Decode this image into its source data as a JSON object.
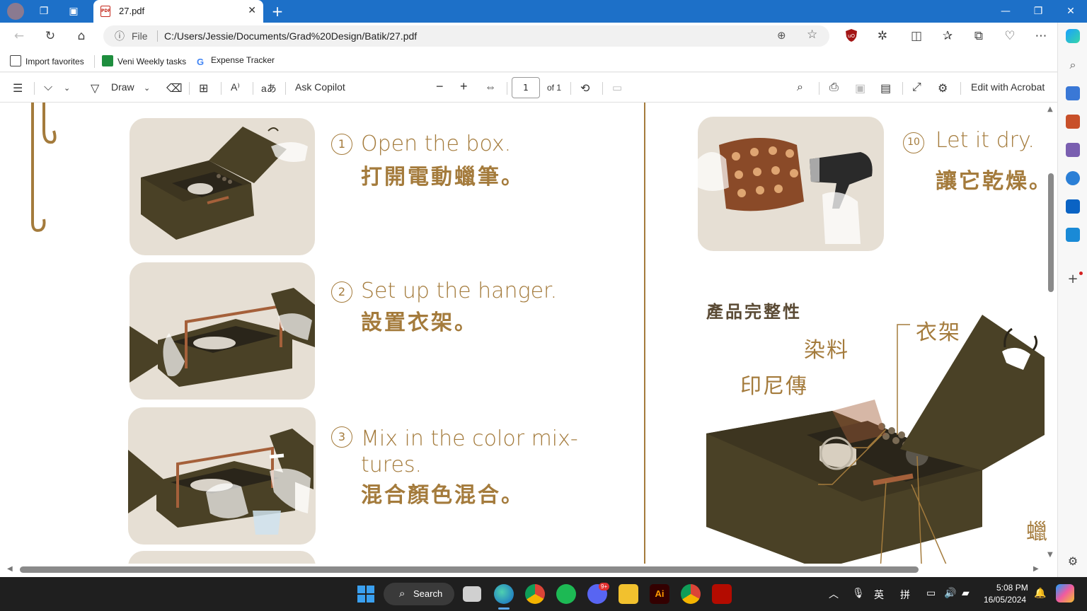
{
  "browser": {
    "tab_title": "27.pdf",
    "new_tab_symbol": "+",
    "url_prefix": "File",
    "url": "C:/Users/Jessie/Documents/Grad%20Design/Batik/27.pdf",
    "favorites": [
      {
        "label": "Import favorites",
        "icon": "import-icon"
      },
      {
        "label": "Veni Weekly tasks",
        "icon": "sheets-icon"
      },
      {
        "label": "Expense Tracker",
        "icon": "google-icon"
      }
    ]
  },
  "pdf_toolbar": {
    "draw_label": "Draw",
    "ask_copilot_label": "Ask Copilot",
    "page_number": "1",
    "page_total": "of 1",
    "edit_label": "Edit with Acrobat"
  },
  "document": {
    "steps": [
      {
        "num": "1",
        "en": "Open the box.",
        "zh": "打開電動蠟筆。"
      },
      {
        "num": "2",
        "en": "Set up the hanger.",
        "zh": "設置衣架。"
      },
      {
        "num": "3",
        "en": "Mix in the color mix-",
        "en2": "tures.",
        "zh": "混合顏色混合。"
      },
      {
        "num": "10",
        "en": "Let it dry.",
        "zh": "讓它乾燥。"
      }
    ],
    "section_title": "產品完整性",
    "callouts": {
      "hanger": "衣架",
      "dye": "染料",
      "indonesia": "印尼傳",
      "wax": "蠟"
    }
  },
  "taskbar": {
    "search_label": "Search",
    "lang_1": "英",
    "lang_2": "拼",
    "time": "5:08 PM",
    "date": "16/05/2024",
    "discord_badge": "9+"
  },
  "colors": {
    "accent_gold": "#a47b3c",
    "titlebar_blue": "#1d70c8",
    "card_bg": "#e6dfd4",
    "box_olive": "#4a4126"
  }
}
